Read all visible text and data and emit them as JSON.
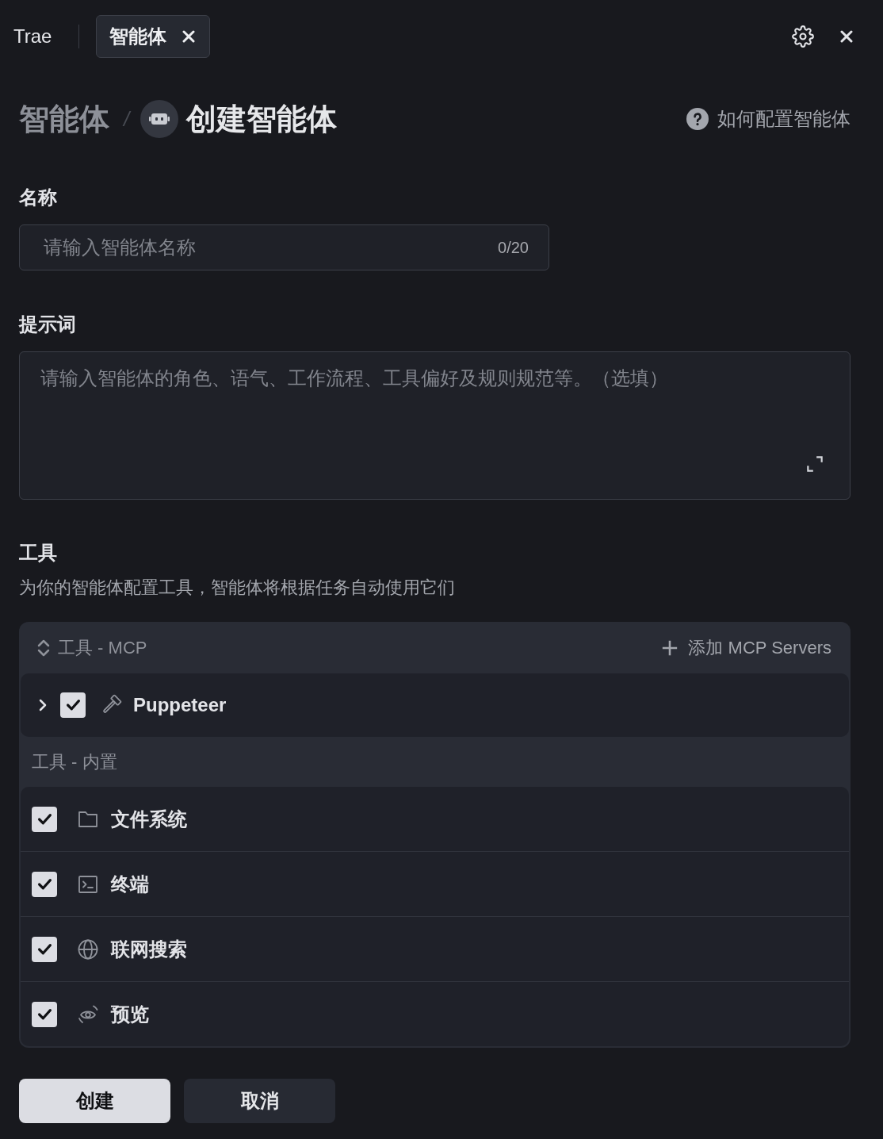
{
  "top_bar": {
    "app_name": "Trae",
    "tabs": [
      {
        "label": "智能体",
        "selected": true
      }
    ]
  },
  "breadcrumb": {
    "parent": "智能体",
    "separator": "/",
    "current": "创建智能体",
    "help_link": "如何配置智能体"
  },
  "name_field": {
    "label": "名称",
    "placeholder": "请输入智能体名称",
    "counter": "0/20"
  },
  "prompt_field": {
    "label": "提示词",
    "placeholder": "请输入智能体的角色、语气、工作流程、工具偏好及规则规范等。（选填）"
  },
  "tools": {
    "title": "工具",
    "description": "为你的智能体配置工具，智能体将根据任务自动使用它们",
    "mcp": {
      "title": "工具 - MCP",
      "add_button": "添加 MCP Servers",
      "items": [
        {
          "name": "Puppeteer",
          "checked": true,
          "expanded": false
        }
      ]
    },
    "builtin": {
      "title": "工具 - 内置",
      "items": [
        {
          "name": "文件系统",
          "kind": "folder",
          "checked": true
        },
        {
          "name": "终端",
          "kind": "terminal",
          "checked": true
        },
        {
          "name": "联网搜索",
          "kind": "globe",
          "checked": true
        },
        {
          "name": "预览",
          "kind": "eye",
          "checked": true
        }
      ]
    }
  },
  "buttons": [
    {
      "label": "创建",
      "kind": "primary"
    },
    {
      "label": "取消",
      "kind": "secondary"
    }
  ]
}
